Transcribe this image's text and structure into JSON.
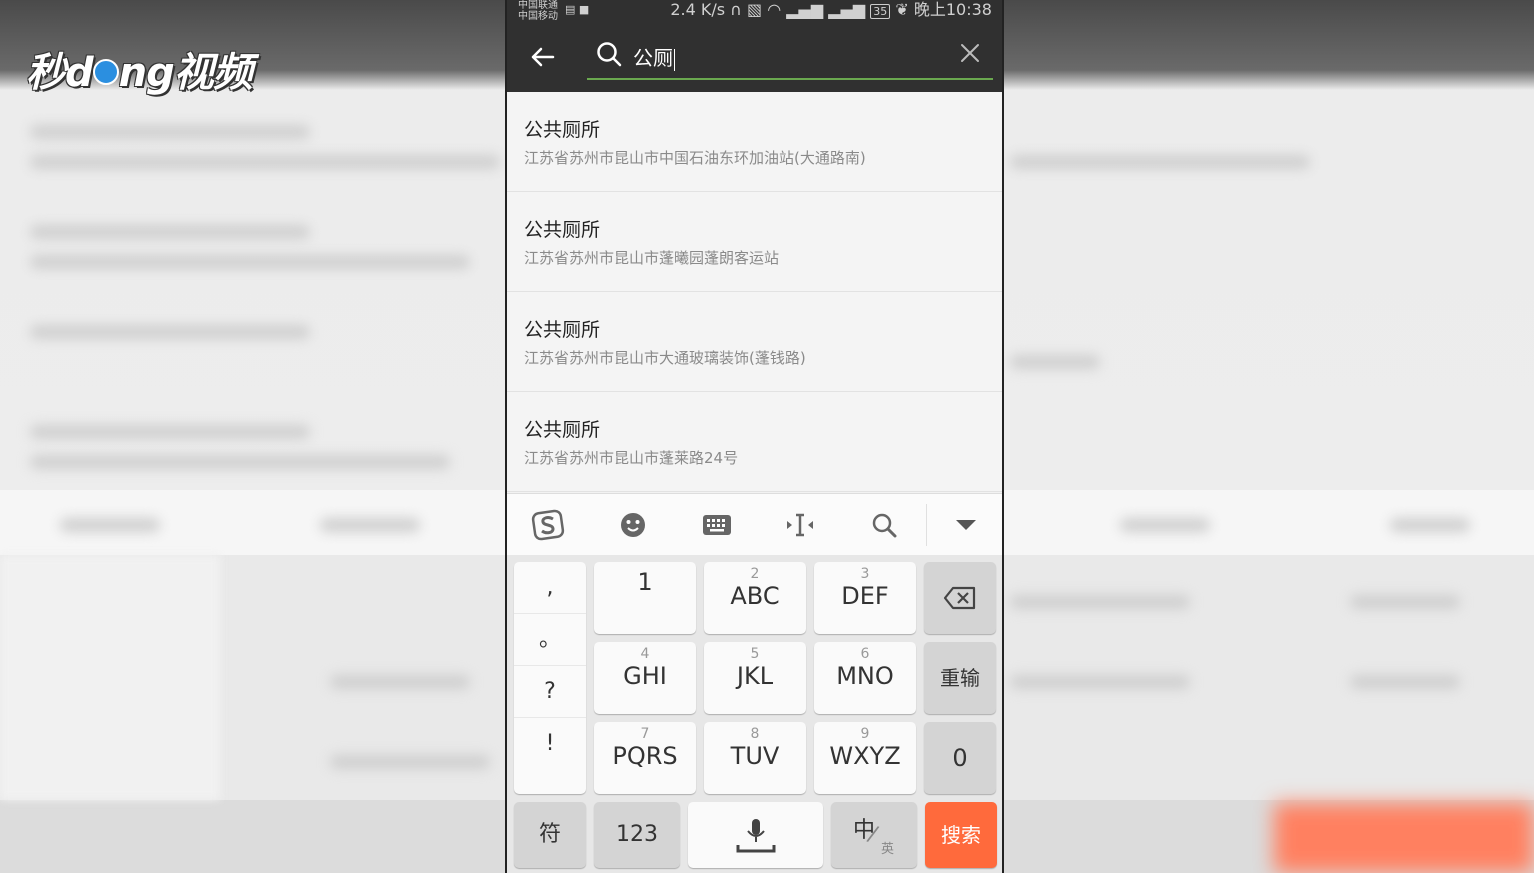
{
  "watermark": {
    "logo_text_a": "秒d",
    "logo_text_b": "ng视频"
  },
  "status_bar": {
    "carrier_1": "中国联通",
    "carrier_2": "中国移动",
    "speed": "2.4 K/s",
    "battery": "35",
    "time": "晚上10:38"
  },
  "search": {
    "query": "公厕"
  },
  "results": [
    {
      "name": "公共厕所",
      "address": "江苏省苏州市昆山市中国石油东环加油站(大通路南)"
    },
    {
      "name": "公共厕所",
      "address": "江苏省苏州市昆山市蓬曦园蓬朗客运站"
    },
    {
      "name": "公共厕所",
      "address": "江苏省苏州市昆山市大通玻璃装饰(蓬钱路)"
    },
    {
      "name": "公共厕所",
      "address": "江苏省苏州市昆山市蓬莱路24号"
    }
  ],
  "keyboard": {
    "punctuation": [
      ",",
      "。",
      "?",
      "!"
    ],
    "keys": [
      {
        "num": "",
        "letters": "1"
      },
      {
        "num": "2",
        "letters": "ABC"
      },
      {
        "num": "3",
        "letters": "DEF"
      },
      {
        "num": "4",
        "letters": "GHI"
      },
      {
        "num": "5",
        "letters": "JKL"
      },
      {
        "num": "6",
        "letters": "MNO"
      },
      {
        "num": "7",
        "letters": "PQRS"
      },
      {
        "num": "8",
        "letters": "TUV"
      },
      {
        "num": "9",
        "letters": "WXYZ"
      }
    ],
    "reenter": "重输",
    "zero": "0",
    "symbols": "符",
    "num_mode": "123",
    "lang_main": "中",
    "lang_sub": "英",
    "search_key": "搜索"
  },
  "colors": {
    "search_key_bg": "#ff6a3c",
    "search_underline": "#6aa84f",
    "toolbar_dark": "#303030"
  }
}
